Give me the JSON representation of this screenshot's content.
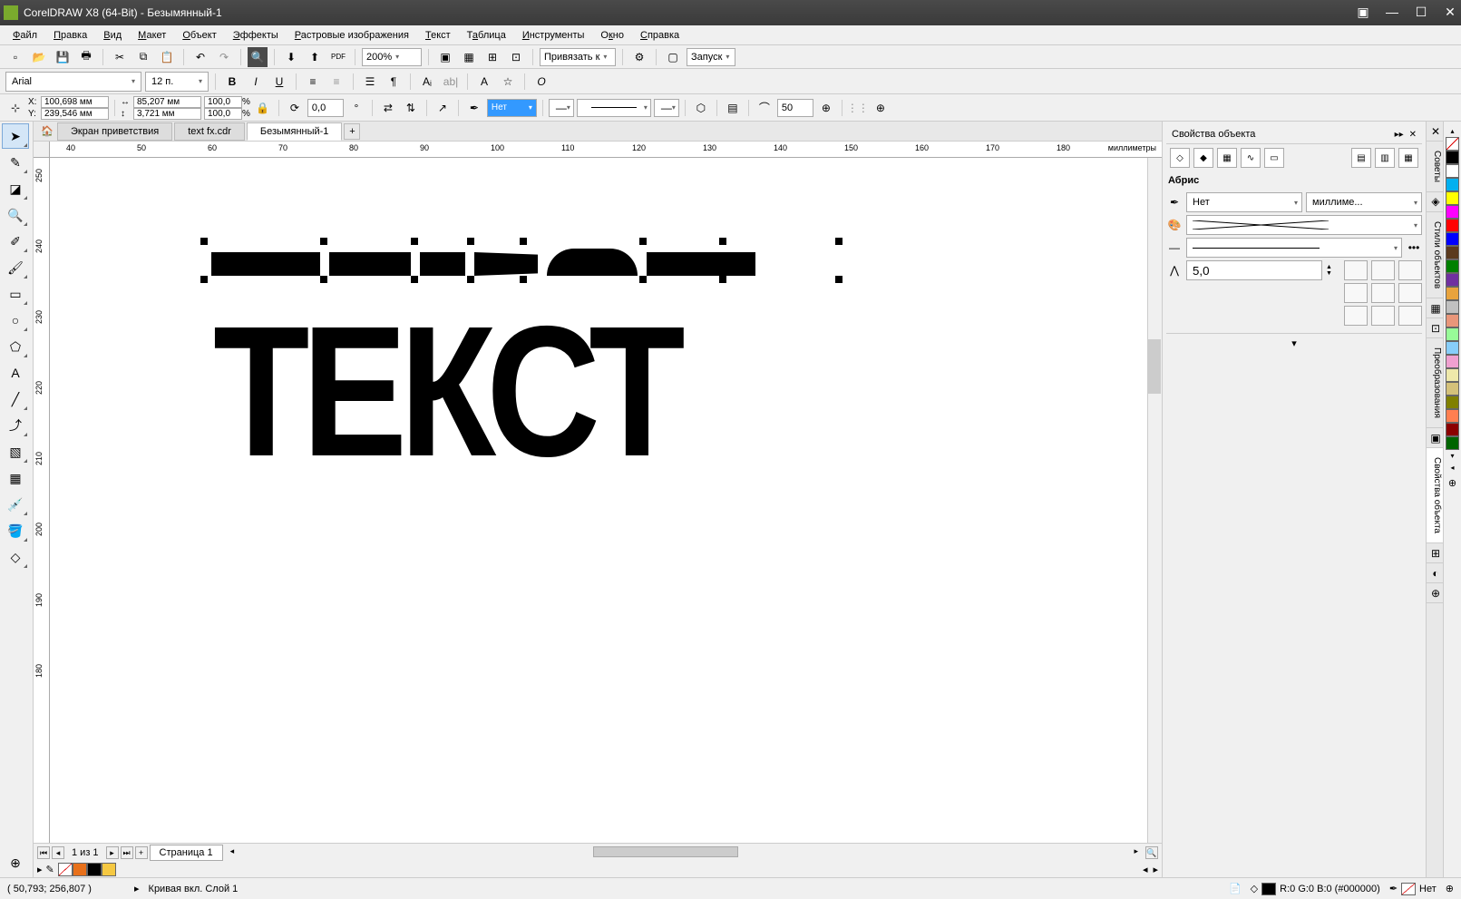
{
  "title": "CorelDRAW X8 (64-Bit) - Безымянный-1",
  "menu": {
    "file": "Файл",
    "edit": "Правка",
    "view": "Вид",
    "layout": "Макет",
    "object": "Объект",
    "effects": "Эффекты",
    "bitmaps": "Растровые изображения",
    "text": "Текст",
    "table": "Таблица",
    "tools": "Инструменты",
    "window": "Окно",
    "help": "Справка"
  },
  "toolbar": {
    "zoom": "200%",
    "snap_to": "Привязать к",
    "launch": "Запуск"
  },
  "text_bar": {
    "font": "Arial",
    "size": "12 п."
  },
  "props": {
    "x": "100,698 мм",
    "y": "239,546 мм",
    "w": "85,207 мм",
    "h": "3,721 мм",
    "sx": "100,0",
    "sy": "100,0",
    "pct": "%",
    "rotation": "0,0",
    "fill": "Нет",
    "outline_w": "50"
  },
  "tabs": {
    "welcome": "Экран приветствия",
    "file1": "text fx.cdr",
    "file2": "Безымянный-1"
  },
  "ruler_unit": "миллиметры",
  "ruler_h": [
    "40",
    "50",
    "60",
    "70",
    "80",
    "90",
    "100",
    "110",
    "120",
    "130",
    "140",
    "150",
    "160",
    "170",
    "180"
  ],
  "ruler_v": [
    "250",
    "240",
    "230",
    "220",
    "210",
    "200",
    "190",
    "180"
  ],
  "canvas": {
    "text": "ТЕКСТ"
  },
  "page_nav": {
    "info": "1 из 1",
    "tab": "Страница 1"
  },
  "docker": {
    "title": "Свойства объекта",
    "section": "Абрис",
    "outline_value": "Нет",
    "outline_unit": "миллиме...",
    "miter": "5,0"
  },
  "side_tabs": {
    "hints": "Советы",
    "styles": "Стили объектов",
    "transforms": "Преобразования",
    "props": "Свойства объекта"
  },
  "palette": [
    "#000000",
    "#ffffff",
    "#00b0f0",
    "#ffff00",
    "#ff00ff",
    "#ff0000",
    "#0000ff",
    "#5b3a1e",
    "#008000",
    "#7030a0",
    "#e8a33d",
    "#c0c0c0",
    "#e9967a",
    "#98fb98",
    "#87cefa",
    "#f0a0d0",
    "#eee8aa",
    "#d4c17a",
    "#808000",
    "#ff7f50",
    "#8b0000",
    "#006400"
  ],
  "statusbar": {
    "coords": "( 50,793; 256,807 )",
    "layer": "Кривая вкл. Слой 1",
    "fill": "R:0 G:0 B:0 (#000000)",
    "outline_none": "Нет"
  }
}
